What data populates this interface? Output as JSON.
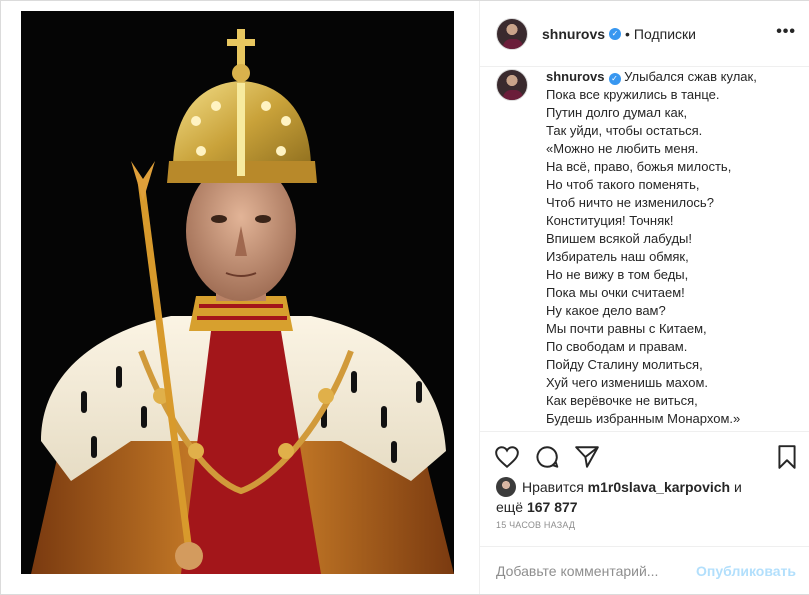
{
  "post": {
    "author": "shnurovs",
    "follow_label": "Подписки",
    "more_glyph": "•••",
    "caption_lines": [
      "Улыбался сжав кулак,",
      "Пока все кружились в танце.",
      "Путин долго думал как,",
      "Так уйди, чтобы остаться.",
      "«Можно не любить меня.",
      "На всё, право, божья милость,",
      "Но чтоб такого поменять,",
      "Чтоб ничто не изменилось?",
      "Конституция! Точняк!",
      "Впишем всякой лабуды!",
      "Избиратель наш обмяк,",
      "Но не вижу в том беды,",
      "Пока мы очки считаем!",
      "Ну какое дело вам?",
      "Мы почти равны с Китаем,",
      "По свободам и правам.",
      "Пойду Сталину молиться,",
      "Хуй чего изменишь махом.",
      "Как верёвочке не виться,",
      "Будешь избранным Монархом.»"
    ],
    "likes": {
      "prefix": "Нравится",
      "liker": "m1r0slava_karpovich",
      "and": "и",
      "more_prefix": "ещё",
      "count": "167 877"
    },
    "time_ago": "15 часов назад",
    "comment_placeholder": "Добавьте комментарий...",
    "publish_label": "Опубликовать"
  },
  "icons": {
    "like": "heart-icon",
    "comment": "comment-icon",
    "share": "share-icon",
    "save": "bookmark-icon",
    "verified": "verified-badge-icon"
  },
  "colors": {
    "link_blue": "#3897f0",
    "publish_disabled": "#b2dffc",
    "muted": "#8e8e8e",
    "text": "#262626"
  }
}
